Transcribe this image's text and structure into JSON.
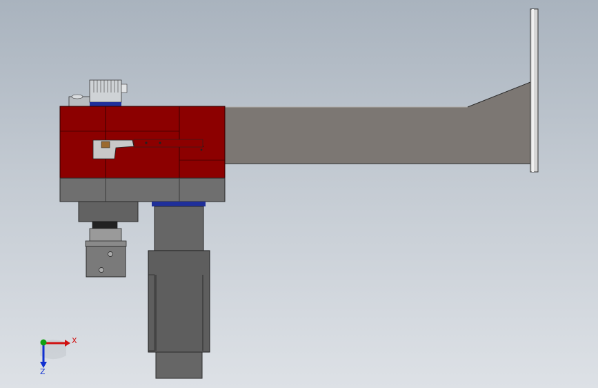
{
  "viewport": {
    "background_top": "#a9b3be",
    "background_bottom": "#dde1e6"
  },
  "colors": {
    "housing_red": "#8c0000",
    "housing_gray": "#6f6f6f",
    "arm_gray": "#7c7773",
    "flange": "#d2d2d2",
    "motor_gray": "#666666",
    "seal_blue": "#1f2f9a",
    "axis_x": "#d01010",
    "axis_y": "#10a010",
    "axis_z": "#1030d0"
  },
  "triad": {
    "x_label": "X",
    "z_label": "Z",
    "icons": [
      "x-axis-arrow-icon",
      "y-axis-dot-icon",
      "z-axis-arrow-icon"
    ]
  }
}
